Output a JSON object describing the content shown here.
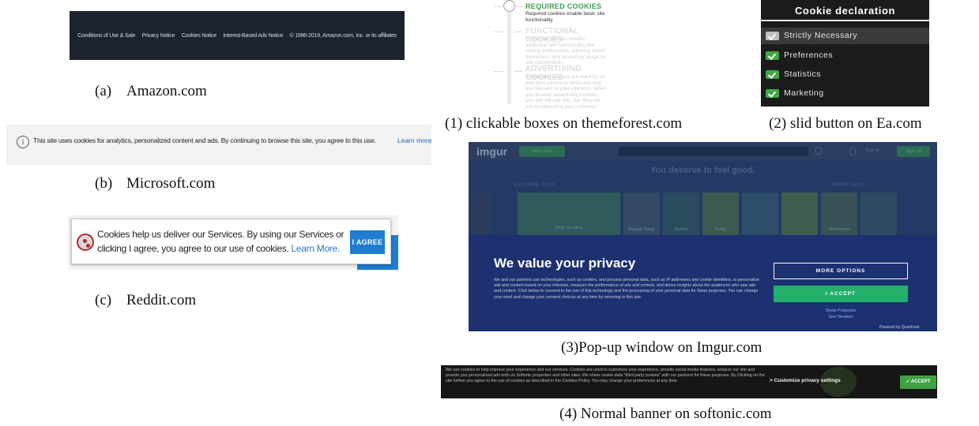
{
  "figure": {
    "amazon": {
      "footer_links": [
        "Conditions of Use & Sale",
        "Privacy Notice",
        "Cookies Notice",
        "Interest-Based Ads Notice",
        "© 1996-2019, Amazon.com, Inc. or its affiliates"
      ],
      "caption_letter": "(a)",
      "caption_site": "Amazon.com"
    },
    "microsoft": {
      "info_icon": "i",
      "banner_text": "This site uses cookies for analytics, personalized content and ads. By continuing to browse this site, you agree to this use.",
      "learn_more": "Learn more",
      "caption_letter": "(b)",
      "caption_site": "Microsoft.com"
    },
    "reddit": {
      "banner_text": "Cookies help us deliver our Services. By using our Services or clicking I agree, you agree to our use of cookies.",
      "learn_more": "Learn More.",
      "agree_button": "I AGREE",
      "caption_letter": "(c)",
      "caption_site": "Reddit.com"
    },
    "themeforest": {
      "sections": [
        {
          "title": "REQUIRED COOKIES",
          "body": "Required cookies enable basic site functionality."
        },
        {
          "title": "FUNCTIONAL COOKIES",
          "body": "Functional cookies enable additional site functionality like saving preferences, allowing social interaction, and analyzing usage for site optimization."
        },
        {
          "title": "ADVERTISING COOKIES",
          "body": "Advertising cookies are used by us and third parties to show ads that are relevant to your interests. When you disable advertising cookies, you will still see ads, but they will not be tailored to your interests."
        }
      ],
      "caption": "(1) clickable boxes on themeforest.com"
    },
    "ea": {
      "title": "Cookie declaration",
      "options": [
        {
          "label": "Strictly Necessary"
        },
        {
          "label": "Preferences"
        },
        {
          "label": "Statistics"
        },
        {
          "label": "Marketing"
        }
      ],
      "caption": "(2) slid button on Ea.com"
    },
    "imgur": {
      "logo": "imgur",
      "new_post": "New post",
      "sign_in": "Sign in",
      "sign_up": "Sign up",
      "tagline": "You deserve to feel good.",
      "explore_tags": "EXPLORE TAGS",
      "more_tags": "MORE TAGS +",
      "tiles": [
        "Daily Scrolling",
        "Strange Things",
        "Memes",
        "Funny",
        "",
        "Wholesome"
      ],
      "panel_title": "We value your privacy",
      "panel_body": "We and our partners use technologies, such as cookies, and process personal data, such as IP addresses and cookie identifiers, to personalise ads and content based on your interests, measure the performance of ads and content, and derive insights about the audiences who saw ads and content. Click below to consent to the use of this technology and the processing of your personal data for these purposes. You can change your mind and change your consent choices at any time by returning to this site.",
      "more_options": "MORE OPTIONS",
      "accept": "I ACCEPT",
      "show_purposes": "Show Purposes",
      "see_vendors": "See Vendors",
      "powered_by": "Powered by Quantcast",
      "caption": "(3)Pop-up window on Imgur.com"
    },
    "softonic": {
      "banner_text": "We use cookies to help improve your experience and our services. Cookies are used to customize your experience, provide social media features, analyze our site and provide you personalized ads both on Softonic properties and other sites. We share cookie data \"third party cookies\" with our partners for these purposes. By Clicking on the site further you agree to the use of cookies as described in the Cookies Policy. You may change your preferences at any time.",
      "customize": "> Customize privacy settings",
      "accept": "✓ ACCEPT",
      "caption": "(4) Normal banner on softonic.com"
    }
  }
}
